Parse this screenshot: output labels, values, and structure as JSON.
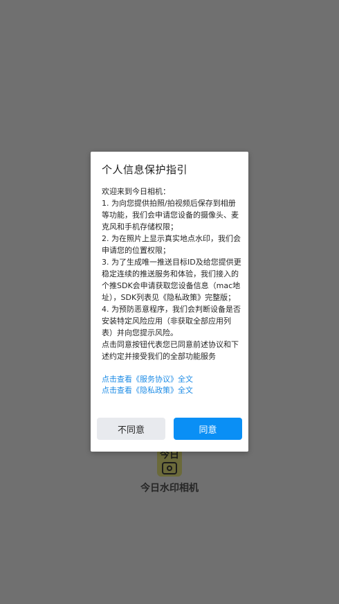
{
  "app": {
    "logo_text": "今日",
    "name": "今日水印相机"
  },
  "dialog": {
    "title": "个人信息保护指引",
    "paragraphs": [
      "欢迎来到今日相机：",
      " 1. 为向您提供拍照/拍视频后保存到相册等功能，我们会申请您设备的摄像头、麦克风和手机存储权限；",
      " 2. 为在照片上显示真实地点水印，我们会申请您的位置权限；",
      " 3. 为了生成唯一推送目标ID及给您提供更稳定连续的推送服务和体验，我们接入的个推SDK会申请获取您设备信息（mac地址），SDK列表见《隐私政策》完整版；",
      " 4. 为预防恶意程序，我们会判断设备是否安装特定风险应用（非获取全部应用列表）并向您提示风险。"
    ],
    "consent": " 点击同意按钮代表您已同意前述协议和下述约定并接受我们的全部功能服务",
    "link_service": "点击查看《服务协议》全文",
    "link_privacy": "点击查看《隐私政策》全文",
    "disagree_label": "不同意",
    "agree_label": "同意"
  },
  "colors": {
    "overlay": "#707070",
    "accent": "#0a8ff5",
    "link": "#1e8ce6"
  }
}
